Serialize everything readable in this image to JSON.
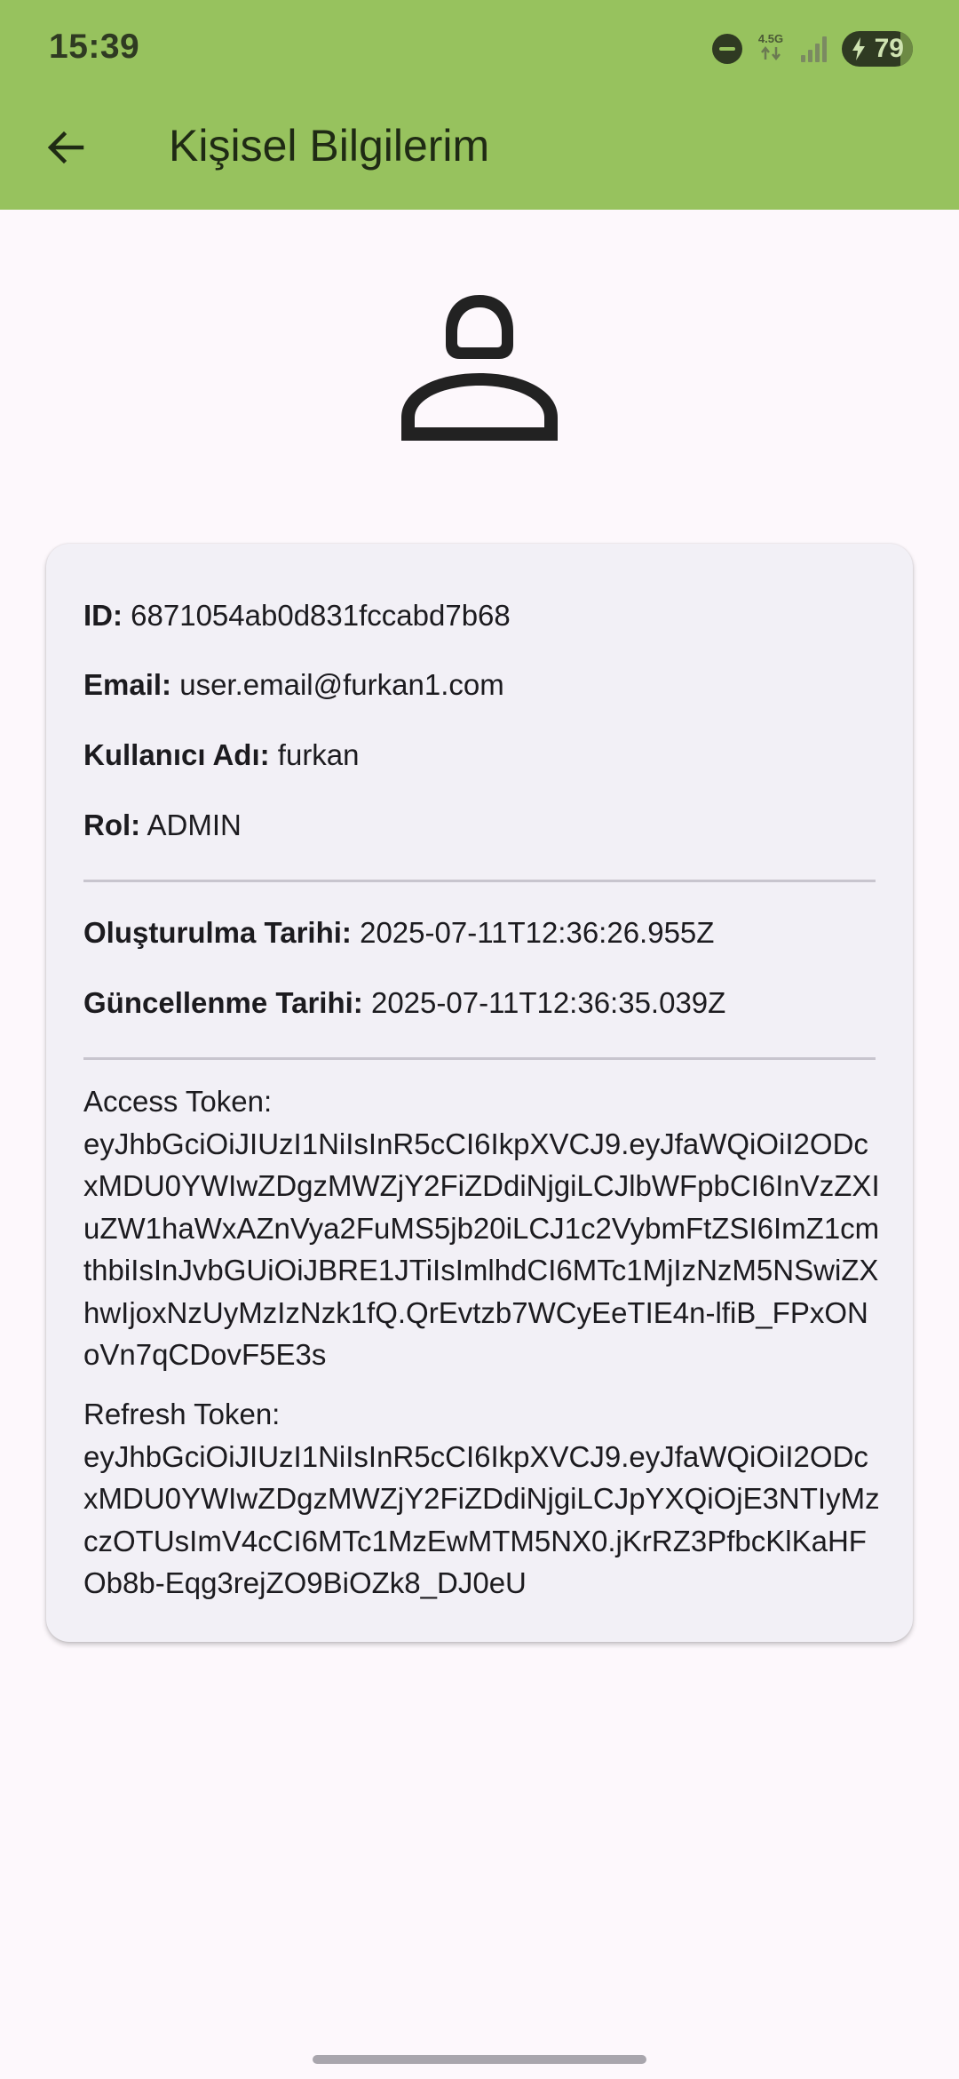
{
  "status_bar": {
    "time": "15:39",
    "network": "4.5G",
    "battery": "79"
  },
  "toolbar": {
    "title": "Kişisel Bilgilerim"
  },
  "profile": {
    "id_label": "ID:",
    "id_value": "6871054ab0d831fccabd7b68",
    "email_label": "Email:",
    "email_value": "user.email@furkan1.com",
    "username_label": "Kullanıcı Adı:",
    "username_value": "furkan",
    "role_label": "Rol:",
    "role_value": "ADMIN",
    "created_label": "Oluşturulma Tarihi:",
    "created_value": "2025-07-11T12:36:26.955Z",
    "updated_label": "Güncellenme Tarihi:",
    "updated_value": "2025-07-11T12:36:35.039Z",
    "access_token_label": "Access Token:",
    "access_token": "eyJhbGciOiJIUzI1NiIsInR5cCI6IkpXVCJ9.eyJfaWQiOiI2ODcxMDU0YWIwZDgzMWZjY2FiZDdiNjgiLCJlbWFpbCI6InVzZXIuZW1haWxAZnVya2FuMS5jb20iLCJ1c2VybmFtZSI6ImZ1cmthbiIsInJvbGUiOiJBRE1JTiIsImlhdCI6MTc1MjIzNzM5NSwiZXhwIjoxNzUyMzIzNzk1fQ.QrEvtzb7WCyEeTIE4n-lfiB_FPxONoVn7qCDovF5E3s",
    "refresh_token_label": "Refresh Token:",
    "refresh_token": "eyJhbGciOiJIUzI1NiIsInR5cCI6IkpXVCJ9.eyJfaWQiOiI2ODcxMDU0YWIwZDgzMWZjY2FiZDdiNjgiLCJpYXQiOjE3NTIyMzczOTUsImV4cCI6MTc1MzEwMTM5NX0.jKrRZ3PfbcKlKaHFOb8b-Eqg3rejZO9BiOZk8_DJ0eU"
  },
  "colors": {
    "appbar": "#97c25e",
    "background": "#fdf8fc",
    "card": "#f2f0f6"
  },
  "icons": {
    "back": "arrow-back-icon",
    "avatar": "person-outline-icon"
  }
}
